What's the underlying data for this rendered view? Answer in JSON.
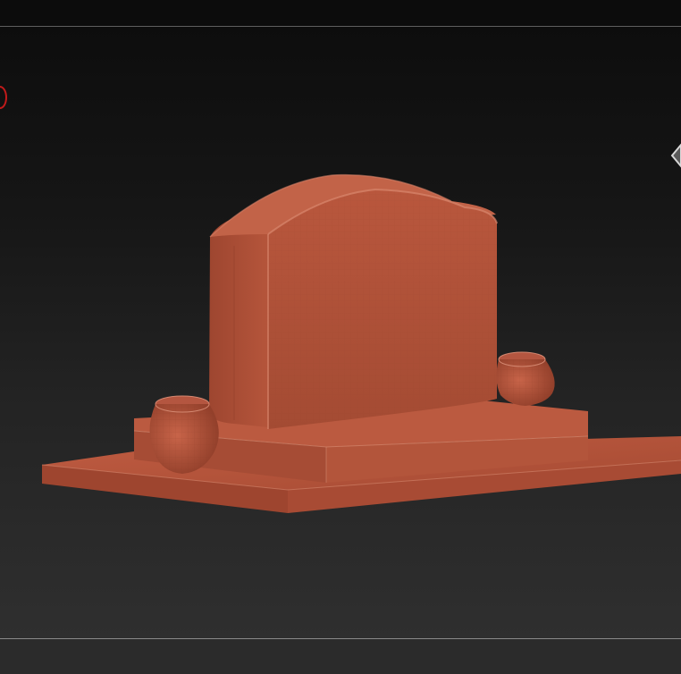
{
  "app": {
    "view": "3D viewport",
    "model": "gravestone",
    "material_color": "#b0523a",
    "background_top": "#0d0d0d",
    "background_bottom": "#2f2f2f"
  },
  "icons": {
    "axis_marker": "red-axis-marker-icon",
    "navigation_gizmo": "view-cube-icon"
  }
}
